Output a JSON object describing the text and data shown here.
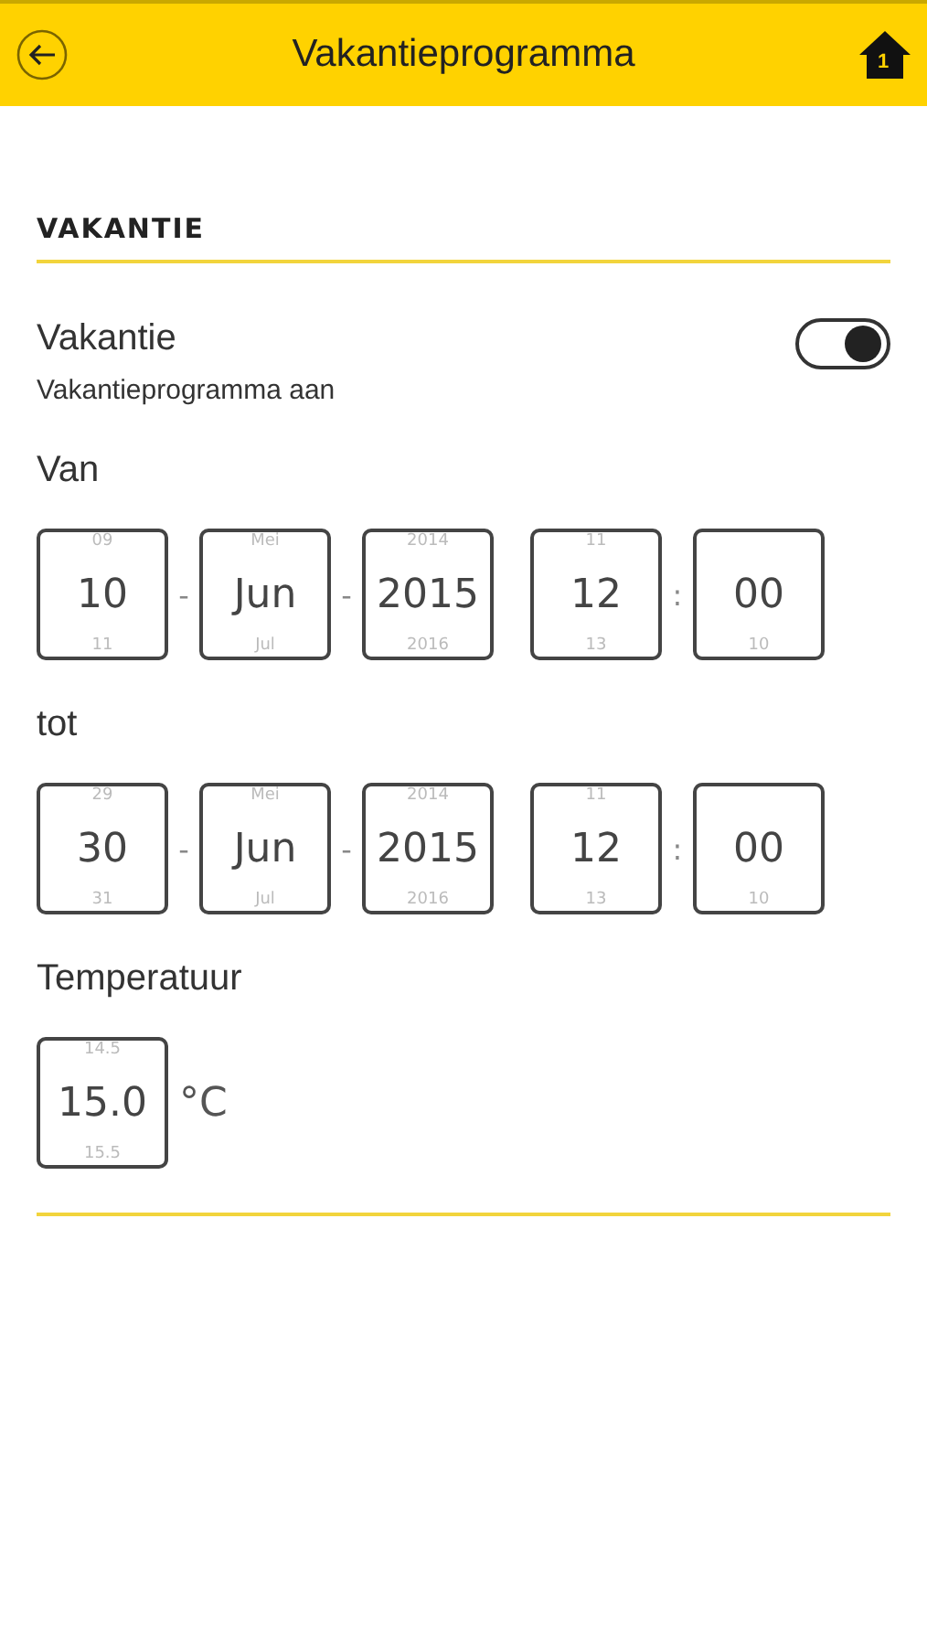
{
  "header": {
    "title": "Vakantieprogramma",
    "home_badge": "1"
  },
  "section": {
    "title": "VAKANTIE"
  },
  "vacation": {
    "label": "Vakantie",
    "sublabel": "Vakantieprogramma aan",
    "on": true
  },
  "ranges": [
    {
      "label": "Van",
      "fields": [
        {
          "prev": "09",
          "value": "10",
          "next": "11",
          "sep": "-"
        },
        {
          "prev": "Mei",
          "value": "Jun",
          "next": "Jul",
          "sep": "-"
        },
        {
          "prev": "2014",
          "value": "2015",
          "next": "2016"
        },
        {
          "prev": "11",
          "value": "12",
          "next": "13",
          "sep": ":"
        },
        {
          "value": "00",
          "next": "10"
        }
      ]
    },
    {
      "label": "tot",
      "fields": [
        {
          "prev": "29",
          "value": "30",
          "next": "31",
          "sep": "-"
        },
        {
          "prev": "Mei",
          "value": "Jun",
          "next": "Jul",
          "sep": "-"
        },
        {
          "prev": "2014",
          "value": "2015",
          "next": "2016"
        },
        {
          "prev": "11",
          "value": "12",
          "next": "13",
          "sep": ":"
        },
        {
          "value": "00",
          "next": "10"
        }
      ]
    }
  ],
  "temperature": {
    "label": "Temperatuur",
    "prev": "14.5",
    "value": "15.0",
    "next": "15.5",
    "unit": "°C"
  }
}
